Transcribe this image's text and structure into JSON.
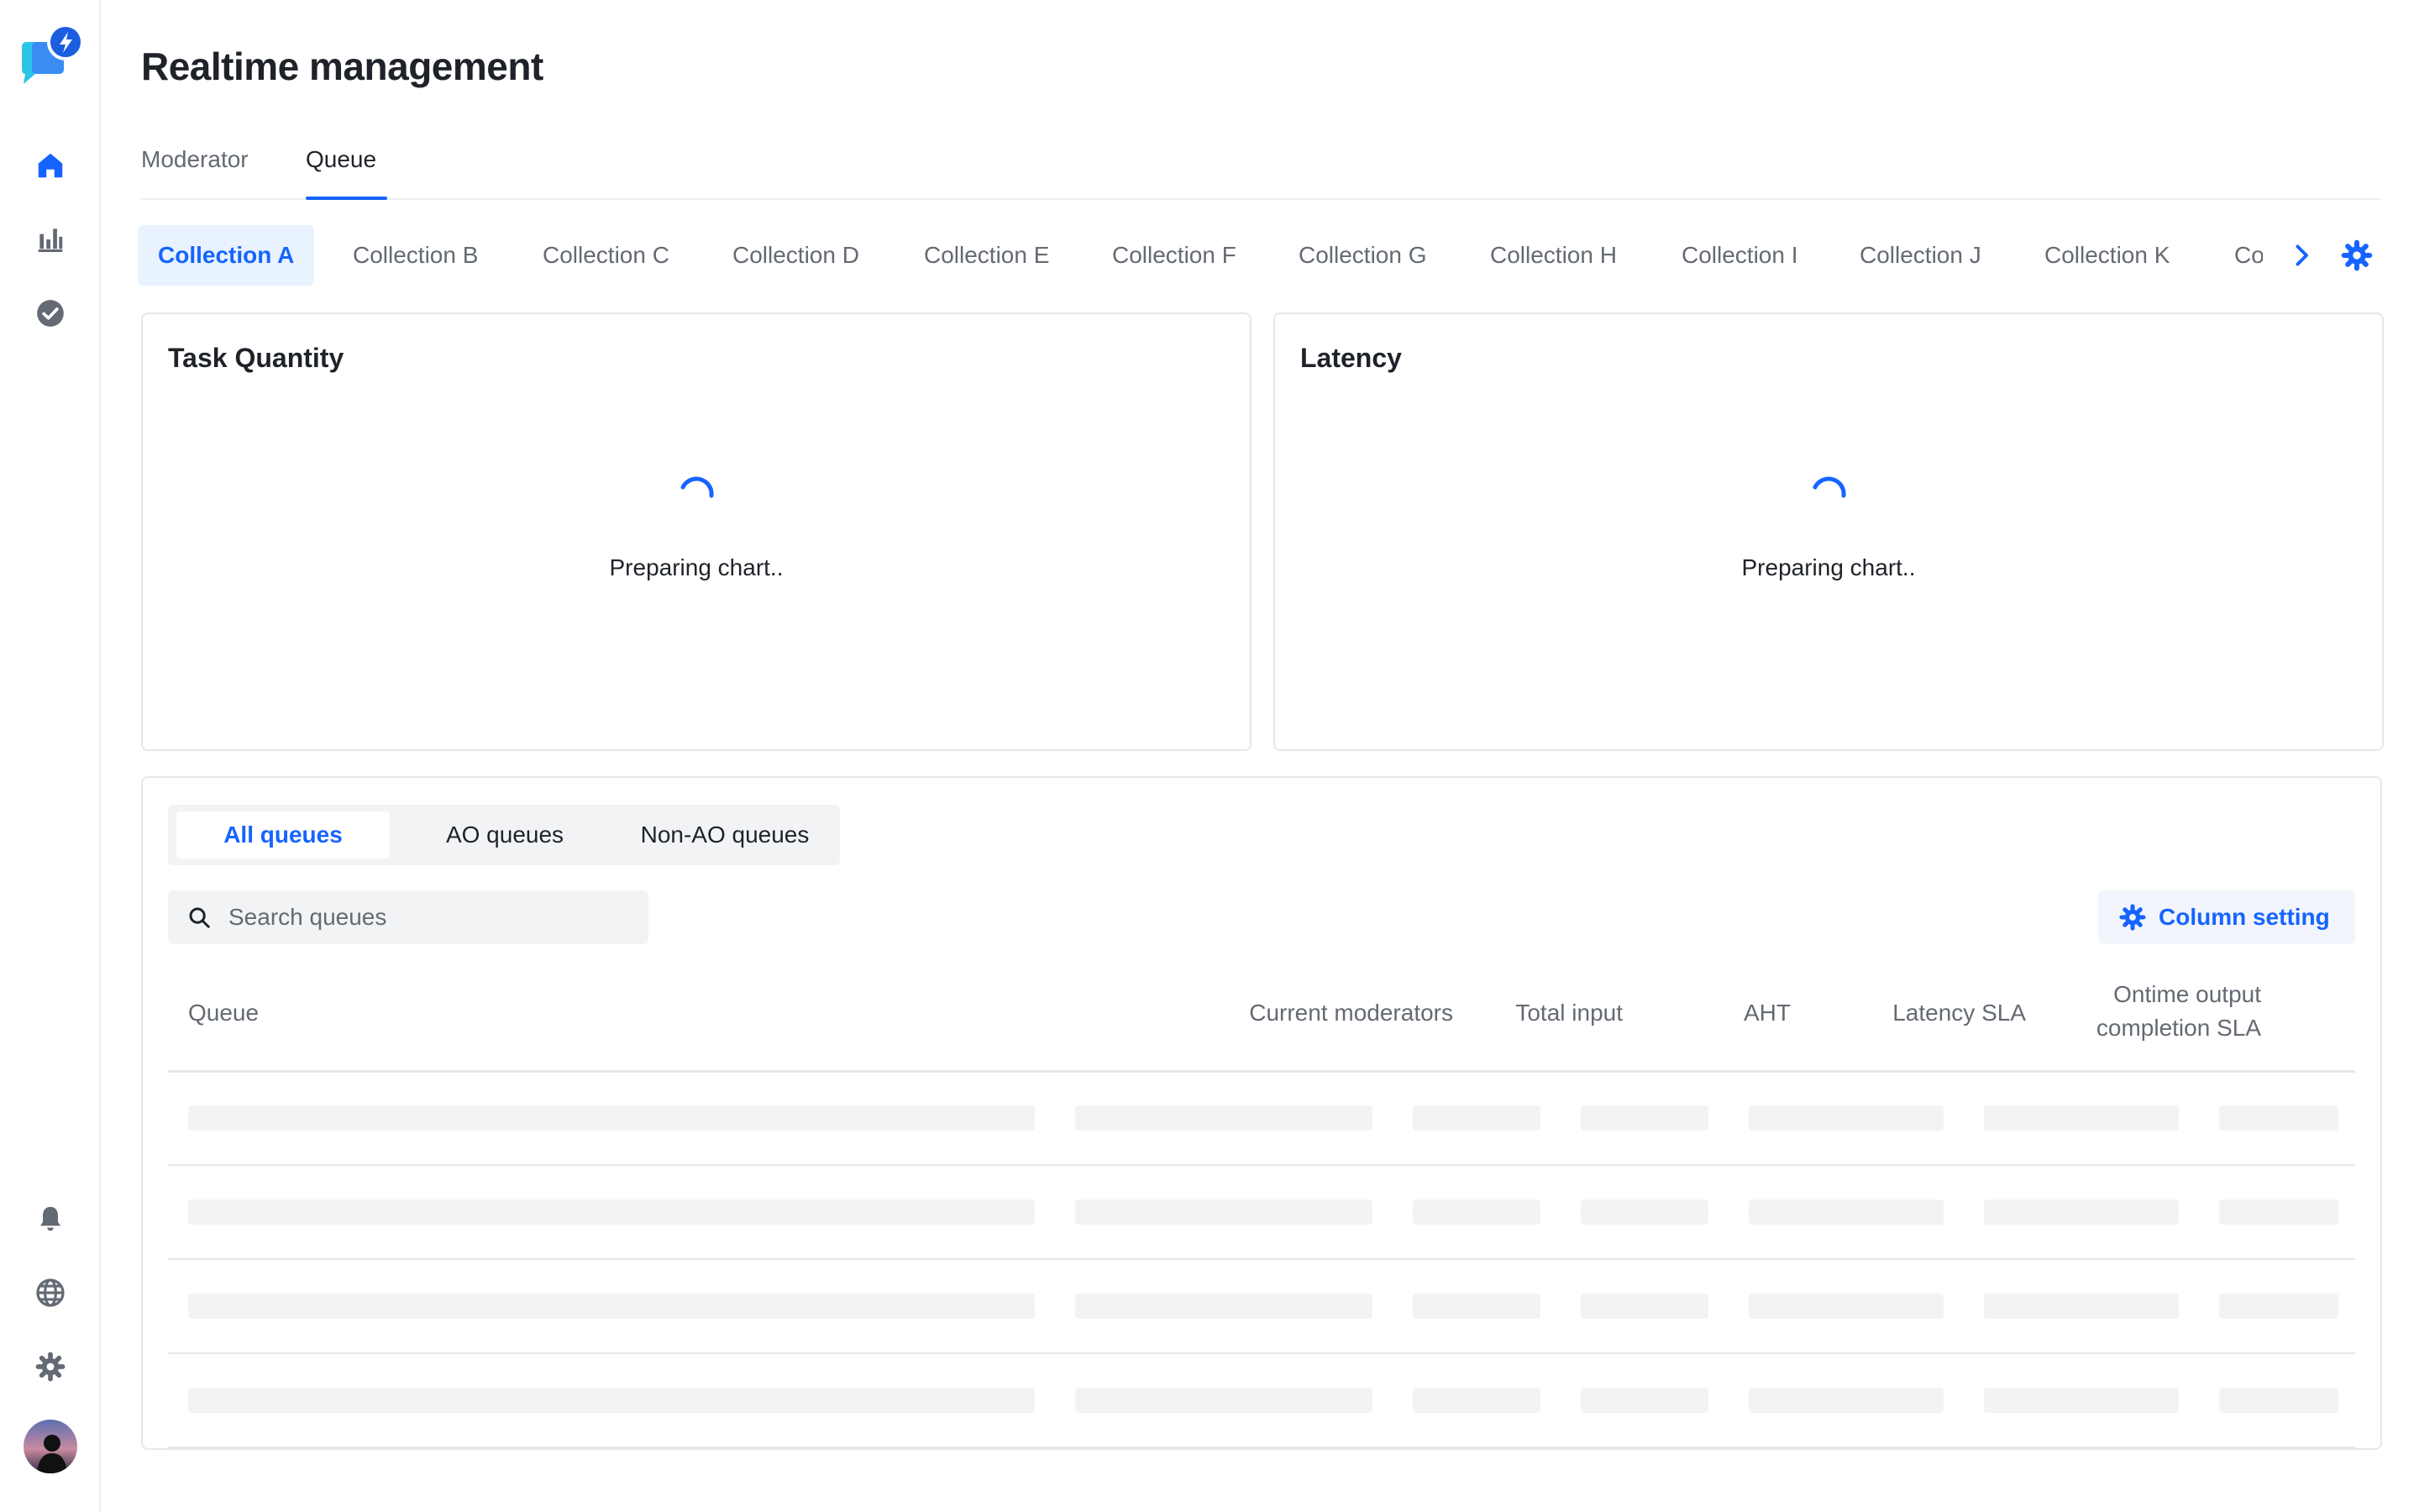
{
  "colors": {
    "accent": "#1664ff",
    "accent_bg": "#e8f3ff",
    "text_primary": "#1f2329",
    "text_secondary": "#646a73",
    "skeleton": "#f2f3f5",
    "border": "#e5e7eb"
  },
  "sidebar": {
    "logo_icon": "chat-bolt-logo-icon",
    "top_items": [
      {
        "name": "home",
        "icon": "home-icon",
        "active": true
      },
      {
        "name": "analytics",
        "icon": "bar-chart-icon",
        "active": false
      },
      {
        "name": "review",
        "icon": "check-circle-icon",
        "active": false
      }
    ],
    "bottom_items": [
      {
        "name": "notifications",
        "icon": "bell-icon"
      },
      {
        "name": "language",
        "icon": "globe-icon"
      },
      {
        "name": "settings",
        "icon": "gear-icon"
      }
    ],
    "avatar": "user-avatar"
  },
  "header": {
    "title": "Realtime management",
    "tabs": [
      {
        "label": "Moderator",
        "active": false
      },
      {
        "label": "Queue",
        "active": true
      }
    ]
  },
  "collections": {
    "tabs": [
      {
        "label": "Collection A",
        "active": true
      },
      {
        "label": "Collection B"
      },
      {
        "label": "Collection C"
      },
      {
        "label": "Collection D"
      },
      {
        "label": "Collection E"
      },
      {
        "label": "Collection F"
      },
      {
        "label": "Collection G"
      },
      {
        "label": "Collection H"
      },
      {
        "label": "Collection I"
      },
      {
        "label": "Collection J"
      },
      {
        "label": "Collection K"
      },
      {
        "label": "Collection L"
      }
    ],
    "next_icon": "chevron-right-icon",
    "settings_icon": "gear-icon"
  },
  "charts": [
    {
      "title": "Task Quantity",
      "status": "Preparing chart.."
    },
    {
      "title": "Latency",
      "status": "Preparing chart.."
    }
  ],
  "queues": {
    "filters": [
      {
        "label": "All queues",
        "active": true
      },
      {
        "label": "AO queues",
        "active": false
      },
      {
        "label": "Non-AO queues",
        "active": false
      }
    ],
    "search": {
      "placeholder": "Search queues",
      "value": ""
    },
    "column_setting_label": "Column setting",
    "columns": [
      {
        "label": "Queue"
      },
      {
        "label": "Current moderators"
      },
      {
        "label": "Total input"
      },
      {
        "label": "AHT"
      },
      {
        "label": "Latency SLA"
      },
      {
        "label_line1": "Ontime output",
        "label_line2": "completion SLA"
      }
    ],
    "loading_rows": 4
  }
}
